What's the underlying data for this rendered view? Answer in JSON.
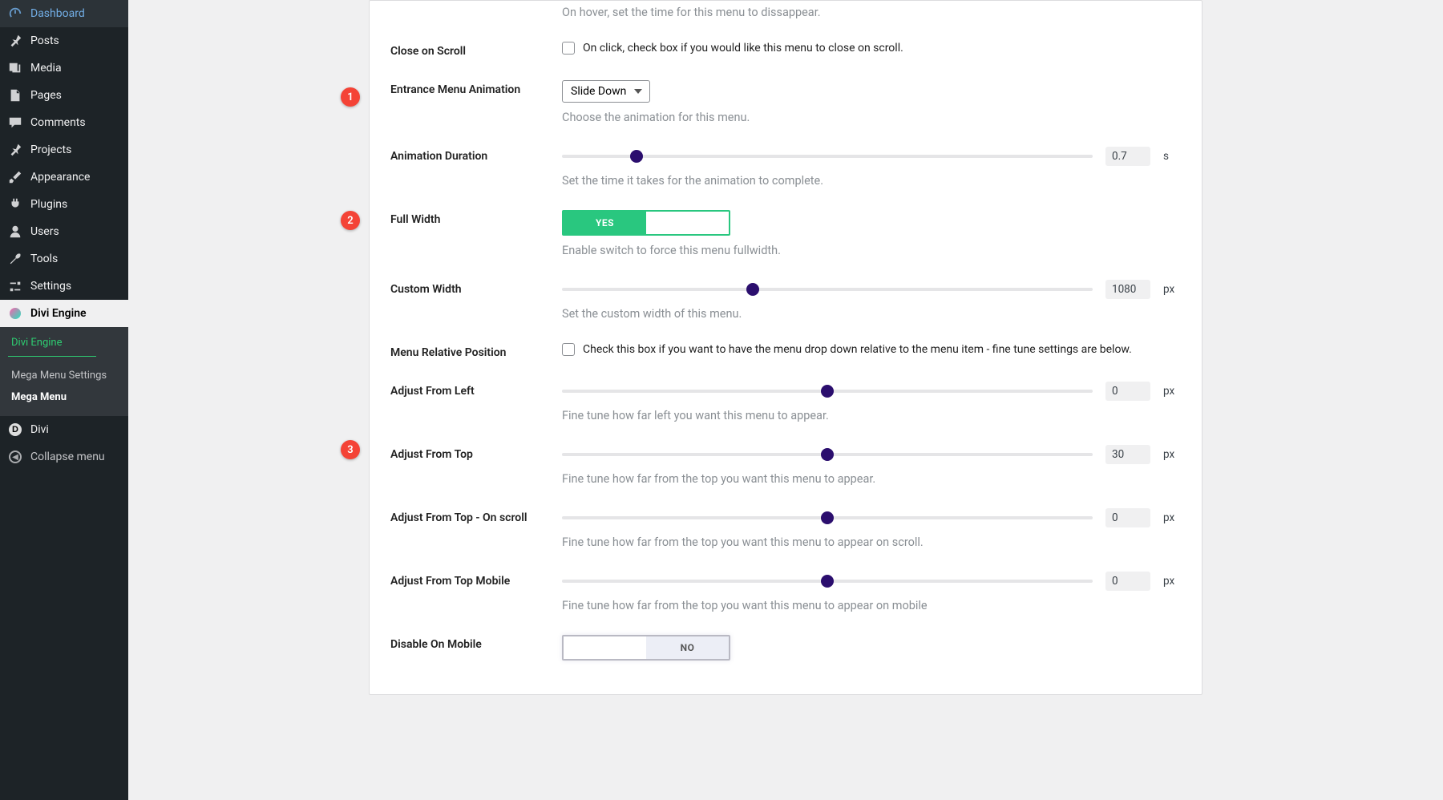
{
  "sidebar": {
    "items": [
      {
        "label": "Dashboard"
      },
      {
        "label": "Posts"
      },
      {
        "label": "Media"
      },
      {
        "label": "Pages"
      },
      {
        "label": "Comments"
      },
      {
        "label": "Projects"
      },
      {
        "label": "Appearance"
      },
      {
        "label": "Plugins"
      },
      {
        "label": "Users"
      },
      {
        "label": "Tools"
      },
      {
        "label": "Settings"
      },
      {
        "label": "Divi Engine"
      },
      {
        "label": "Divi"
      },
      {
        "label": "Collapse menu"
      }
    ],
    "submenu": {
      "items": [
        {
          "label": "Divi Engine"
        },
        {
          "label": "Mega Menu Settings"
        },
        {
          "label": "Mega Menu"
        }
      ]
    }
  },
  "annotations": {
    "a1": "1",
    "a2": "2",
    "a3": "3"
  },
  "settings": {
    "hover_disappear": {
      "desc": "On hover, set the time for this menu to dissappear."
    },
    "close_on_scroll": {
      "label": "Close on Scroll",
      "check_label": "On click, check box if you would like this menu to close on scroll."
    },
    "entrance_animation": {
      "label": "Entrance Menu Animation",
      "value": "Slide Down",
      "desc": "Choose the animation for this menu."
    },
    "animation_duration": {
      "label": "Animation Duration",
      "value": "0.7",
      "unit": "s",
      "thumb_pct": 14,
      "desc": "Set the time it takes for the animation to complete."
    },
    "full_width": {
      "label": "Full Width",
      "toggle_on": "YES",
      "toggle_off": "",
      "desc": "Enable switch to force this menu fullwidth."
    },
    "custom_width": {
      "label": "Custom Width",
      "value": "1080",
      "unit": "px",
      "thumb_pct": 36,
      "desc": "Set the custom width of this menu."
    },
    "menu_relative_position": {
      "label": "Menu Relative Position",
      "check_label": "Check this box if you want to have the menu drop down relative to the menu item - fine tune settings are below."
    },
    "adjust_from_left": {
      "label": "Adjust From Left",
      "value": "0",
      "unit": "px",
      "thumb_pct": 50,
      "desc": "Fine tune how far left you want this menu to appear."
    },
    "adjust_from_top": {
      "label": "Adjust From Top",
      "value": "30",
      "unit": "px",
      "thumb_pct": 50,
      "desc": "Fine tune how far from the top you want this menu to appear."
    },
    "adjust_from_top_scroll": {
      "label": "Adjust From Top - On scroll",
      "value": "0",
      "unit": "px",
      "thumb_pct": 50,
      "desc": "Fine tune how far from the top you want this menu to appear on scroll."
    },
    "adjust_from_top_mobile": {
      "label": "Adjust From Top Mobile",
      "value": "0",
      "unit": "px",
      "thumb_pct": 50,
      "desc": "Fine tune how far from the top you want this menu to appear on mobile"
    },
    "disable_on_mobile": {
      "label": "Disable On Mobile",
      "toggle_on": "",
      "toggle_off": "NO"
    }
  }
}
